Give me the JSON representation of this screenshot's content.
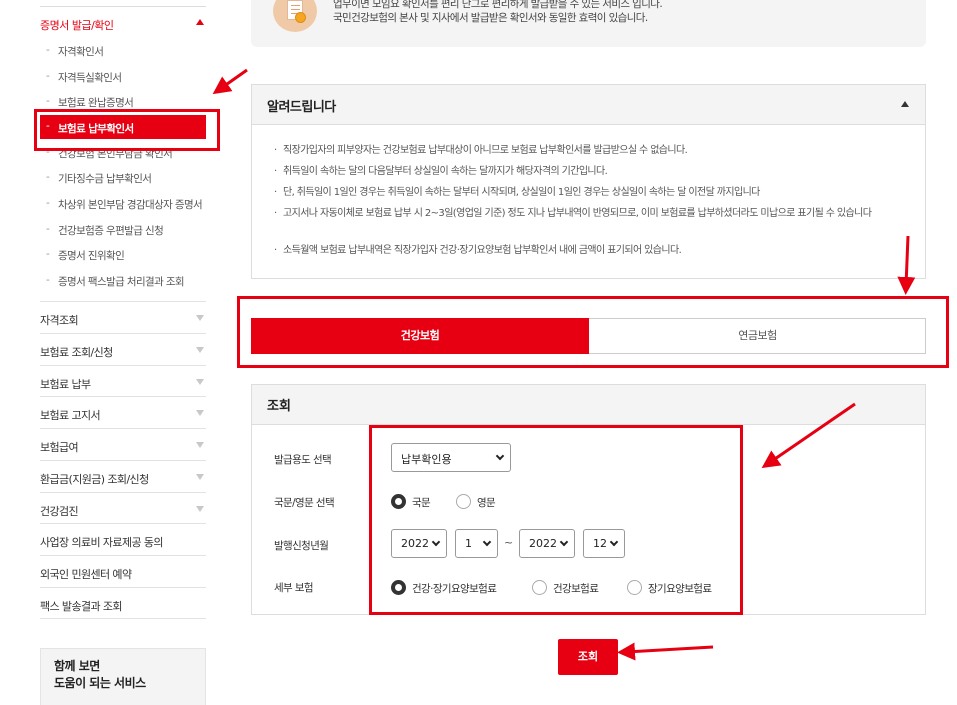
{
  "sidebar": {
    "section_title": "증명서 발급/확인",
    "sub_items": [
      {
        "label": "자격확인서"
      },
      {
        "label": "자격득실확인서"
      },
      {
        "label": "보험료 완납증명서"
      },
      {
        "label": "보험료 납부확인서"
      },
      {
        "label": "건강보험 본인부담금 확인서"
      },
      {
        "label": "기타징수금 납부확인서"
      },
      {
        "label": "차상위 본인부담 경감대상자 증명서"
      },
      {
        "label": "건강보험증 우편발급 신청"
      },
      {
        "label": "증명서 진위확인"
      },
      {
        "label": "증명서 팩스발급 처리결과 조회"
      }
    ],
    "active_index": 3,
    "menu_items": [
      {
        "label": "자격조회",
        "has_toggle": true
      },
      {
        "label": "보험료 조회/신청",
        "has_toggle": true
      },
      {
        "label": "보험료 납부",
        "has_toggle": true
      },
      {
        "label": "보험료 고지서",
        "has_toggle": true
      },
      {
        "label": "보험급여",
        "has_toggle": true
      },
      {
        "label": "환급금(지원금) 조회/신청",
        "has_toggle": true
      },
      {
        "label": "건강검진",
        "has_toggle": true
      },
      {
        "label": "사업장 의료비 자료제공 동의",
        "has_toggle": false
      },
      {
        "label": "외국인 민원센터 예약",
        "has_toggle": false
      },
      {
        "label": "팩스 발송결과 조회",
        "has_toggle": false
      }
    ],
    "helper": {
      "line1": "함께 보면",
      "line2": "도움이 되는 서비스"
    }
  },
  "top_box": {
    "line1": "업무이면 모임요 확인서를 편리 단그로 편리하게 발급받을 수 있는 서비스 입니다.",
    "line2": "국민건강보험의 본사 및 지사에서 발급받은 확인서와 동일한 효력이 있습니다."
  },
  "notice": {
    "title": "알려드립니다",
    "bullet": "·",
    "items": [
      "직장가입자의 피부양자는 건강보험료 납부대상이 아니므로 보험료 납부확인서를 발급받으실 수 없습니다.",
      "취득일이 속하는 달의 다음달부터 상실일이 속하는 달까지가 해당자격의 기간입니다.",
      "단, 취득일이 1일인 경우는 취득일이 속하는 달부터 시작되며, 상실일이 1일인 경우는 상실일이 속하는 달 이전달 까지입니다",
      "고지서나 자동이체로 보험료 납부 시 2~3일(영업일 기준) 정도 지나 납부내역이 반영되므로, 이미 보험료를 납부하셨더라도 미납으로 표기될 수 있습니다",
      "소득월액 보험료 납부내역은 직장가입자 건강·장기요양보험 납부확인서 내에 금액이 표기되어 있습니다."
    ]
  },
  "tabs": [
    {
      "label": "건강보험",
      "selected": true
    },
    {
      "label": "연금보험",
      "selected": false
    }
  ],
  "search": {
    "title": "조회",
    "purpose_label": "발급용도 선택",
    "purpose_value": "납부확인용",
    "language_label": "국문/영문 선택",
    "language_options": [
      {
        "label": "국문",
        "selected": true
      },
      {
        "label": "영문",
        "selected": false
      }
    ],
    "period_label": "발행신청년월",
    "from_year": "2022",
    "from_month": "1",
    "tilde": "~",
    "to_year": "2022",
    "to_month": "12",
    "detail_label": "세부 보험",
    "detail_options": [
      {
        "label": "건강·장기요양보험료",
        "selected": true
      },
      {
        "label": "건강보험료",
        "selected": false
      },
      {
        "label": "장기요양보험료",
        "selected": false
      }
    ],
    "submit_label": "조회"
  },
  "colors": {
    "accent": "#e60012",
    "panel_bg": "#f4f4f4",
    "border": "#dddddd"
  }
}
